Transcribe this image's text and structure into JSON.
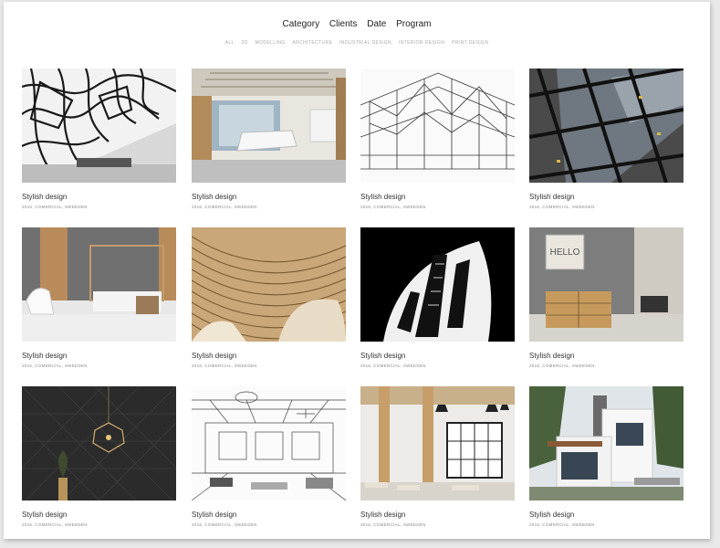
{
  "nav": {
    "items": [
      "Category",
      "Clients",
      "Date",
      "Program"
    ]
  },
  "filters": {
    "items": [
      "ALL",
      "3D",
      "MODELLING",
      "ARCHITECTURE",
      "INDUSTRIAL DESIGN",
      "INTERIOR DESIGN",
      "PRINT DESIGN"
    ]
  },
  "projects": [
    {
      "title": "Stylish design",
      "meta": "2016, COMERCIAL, SWEEDEN"
    },
    {
      "title": "Stylish design",
      "meta": "2016, COMERCIAL, SWEEDEN"
    },
    {
      "title": "Stylish design",
      "meta": "2016, COMERCIAL, SWEEDEN"
    },
    {
      "title": "Stylish design",
      "meta": "2016, COMERCIAL, SWEEDEN"
    },
    {
      "title": "Stylish design",
      "meta": "2016, COMERCIAL, SWEEDEN"
    },
    {
      "title": "Stylish design",
      "meta": "2016, COMERCIAL, SWEEDEN"
    },
    {
      "title": "Stylish design",
      "meta": "2016, COMERCIAL, SWEEDEN"
    },
    {
      "title": "Stylish design",
      "meta": "2016, COMERCIAL, SWEEDEN"
    },
    {
      "title": "Stylish design",
      "meta": "2016, COMERCIAL, SWEEDEN"
    },
    {
      "title": "Stylish design",
      "meta": "2016, COMERCIAL, SWEEDEN"
    },
    {
      "title": "Stylish design",
      "meta": "2016, COMERCIAL, SWEEDEN"
    },
    {
      "title": "Stylish design",
      "meta": "2016, COMERCIAL, SWEEDEN"
    }
  ],
  "decor": {
    "sign_text": "HELLO"
  }
}
